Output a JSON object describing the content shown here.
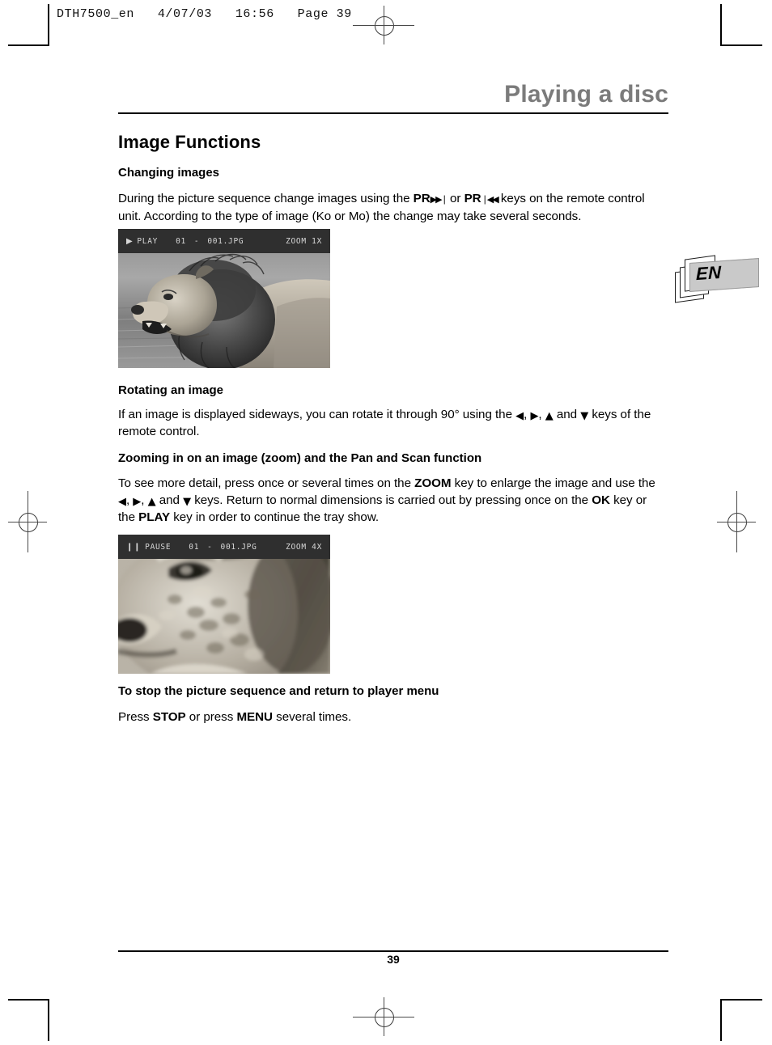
{
  "printer_slug": "DTH7500_en   4/07/03   16:56   Page 39",
  "chapter_title": "Playing a disc",
  "section_title": "Image Functions",
  "language_tab": {
    "label": "EN"
  },
  "page_number": "39",
  "sections": [
    {
      "heading": "Changing images",
      "paragraph_part1": "During the picture sequence change images using the ",
      "key1": "PR",
      "glyph1": "▶▶❘",
      "paragraph_part2": " or ",
      "key2": "PR",
      "glyph2": "❘◀◀",
      "paragraph_part3": " keys on the remote control unit. According to the type of image (Ko or Mo) the change may take several seconds."
    },
    {
      "heading": "Rotating an image",
      "paragraph_part1": "If an image is displayed sideways, you can rotate it through 90° using the ",
      "glyph_left": "◀",
      "glyph_right": "▶",
      "glyph_up": "▲",
      "glyph_down": "▼",
      "paragraph_part2": ", ",
      "paragraph_part3": ", ",
      "paragraph_part4": " and ",
      "paragraph_part5": " keys of the remote control."
    },
    {
      "heading": "Zooming in on an image (zoom) and the Pan and Scan function",
      "p_a": "To see more detail, press once or several times on the ",
      "key_zoom": "ZOOM",
      "p_b": " key to enlarge the image and use the ",
      "glyph_left": "◀",
      "glyph_right": "▶",
      "glyph_up": "▲",
      "glyph_down": "▼",
      "p_c": ", ",
      "p_d": ", ",
      "p_e": " and ",
      "p_f": " keys. Return to normal dimensions is carried out by pressing once on the ",
      "key_ok": "OK",
      "p_g": " key or the ",
      "key_play": "PLAY",
      "p_h": " key in order to continue the tray show."
    },
    {
      "heading": "To stop the picture sequence and return to player menu",
      "p_a": "Press ",
      "key_stop": "STOP",
      "p_b": " or press ",
      "key_menu": "MENU",
      "p_c": " several times."
    }
  ],
  "screenshots": [
    {
      "status_icon": "▶",
      "status": "PLAY",
      "track": "01",
      "separator": "-",
      "filename": "001.JPG",
      "zoom_level": "ZOOM 1X",
      "subject": "lion-photo-normal"
    },
    {
      "status_icon": "❙❙",
      "status": "PAUSE",
      "track": "01",
      "separator": "-",
      "filename": "001.JPG",
      "zoom_level": "ZOOM 4X",
      "subject": "lion-photo-zoomed-4x"
    }
  ],
  "colors": {
    "chapter_title": "#7b7b7b",
    "osd_background": "#2f2f2f",
    "osd_text": "#d8d8d8",
    "language_tab_banner": "#c9c9c9"
  }
}
